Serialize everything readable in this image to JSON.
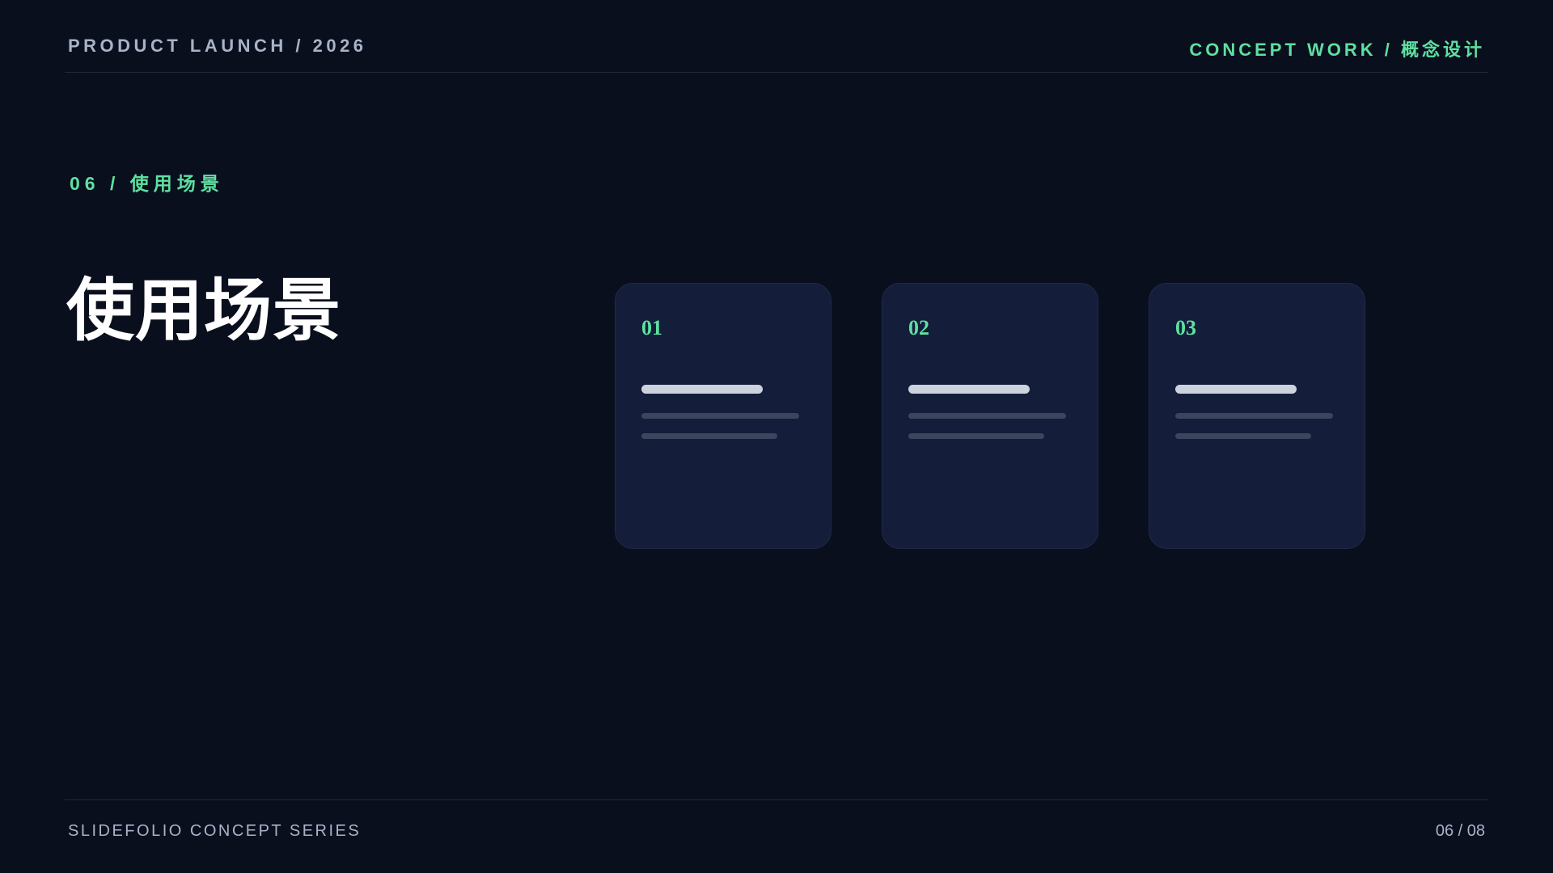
{
  "header": {
    "left": "PRODUCT LAUNCH / 2026",
    "right": "CONCEPT WORK / 概念设计"
  },
  "section": {
    "kicker": "06 / 使用场景",
    "title": "使用场景"
  },
  "cards": [
    {
      "number": "01"
    },
    {
      "number": "02"
    },
    {
      "number": "03"
    }
  ],
  "footer": {
    "series": "SLIDEFOLIO CONCEPT SERIES",
    "page": "06 / 08"
  },
  "colors": {
    "background": "#0a0f1e",
    "accent": "#5ee0a0",
    "card": "#141e3a",
    "muted_text": "#a8b3c7"
  }
}
